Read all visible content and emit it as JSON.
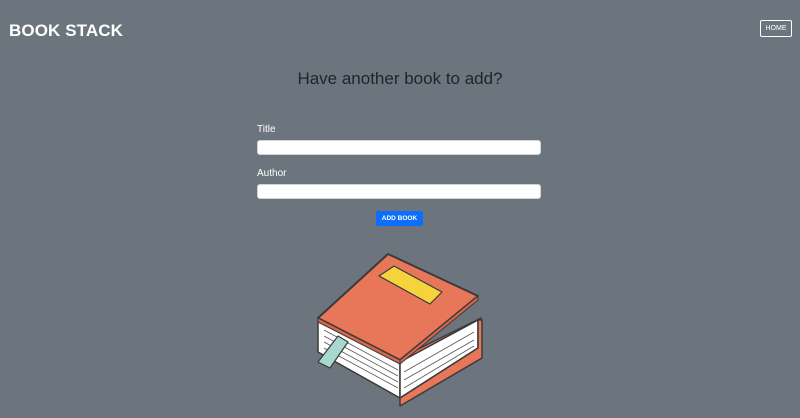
{
  "navbar": {
    "brand": "BOOK STACK",
    "home_label": "HOME"
  },
  "main": {
    "heading": "Have another book to add?"
  },
  "form": {
    "title_label": "Title",
    "title_value": "",
    "author_label": "Author",
    "author_value": "",
    "submit_label": "ADD BOOK"
  },
  "illustration": {
    "icon": "book-icon",
    "colors": {
      "cover": "#e8775a",
      "label": "#f5d33b",
      "pages": "#ffffff",
      "bookmark": "#a8d8cf",
      "outline": "#3a3a3a"
    }
  },
  "colors": {
    "background": "#6c757d",
    "accent": "#0d6efd",
    "heading": "#212529"
  }
}
